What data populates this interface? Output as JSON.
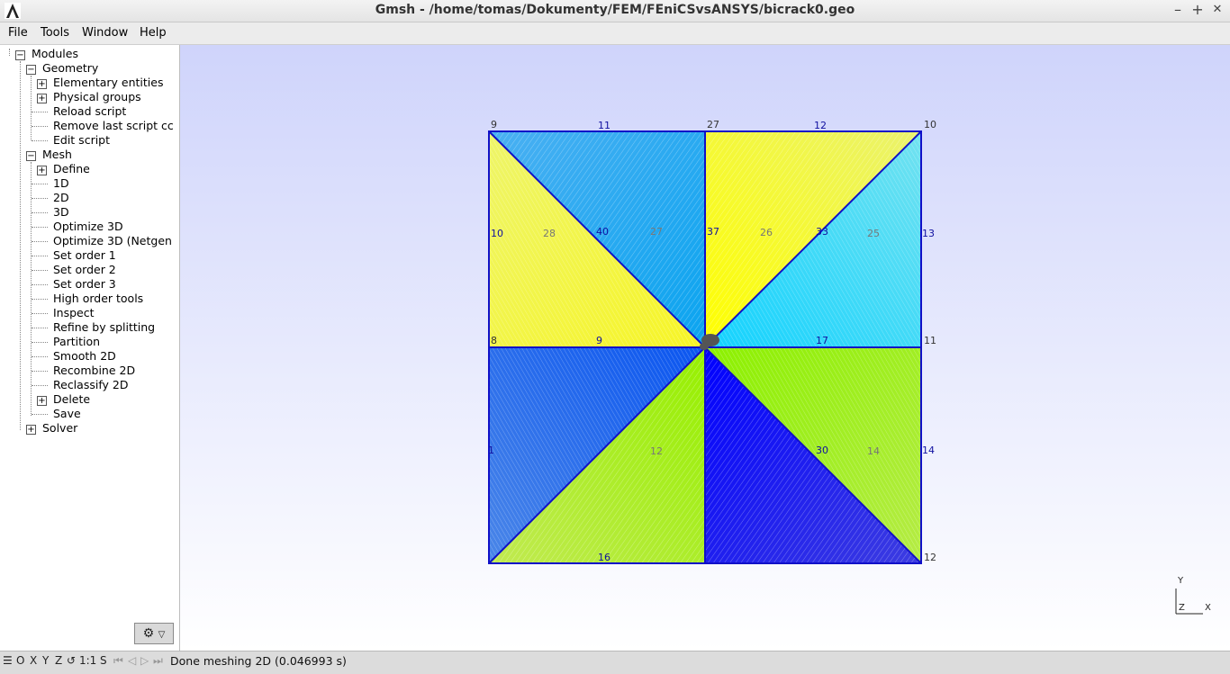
{
  "window": {
    "title": "Gmsh - /home/tomas/Dokumenty/FEM/FEniCSvsANSYS/bicrack0.geo",
    "minimize_label": "–",
    "maximize_label": "+",
    "close_label": "✕"
  },
  "menu": [
    "File",
    "Tools",
    "Window",
    "Help"
  ],
  "tree": {
    "modules": "Modules",
    "geometry": "Geometry",
    "geometry_items": [
      "Elementary entities",
      "Physical groups",
      "Reload script",
      "Remove last script cc",
      "Edit script"
    ],
    "mesh": "Mesh",
    "mesh_items": [
      "Define",
      "1D",
      "2D",
      "3D",
      "Optimize 3D",
      "Optimize 3D (Netgen",
      "Set order 1",
      "Set order 2",
      "Set order 3",
      "High order tools",
      "Inspect",
      "Refine by splitting",
      "Partition",
      "Smooth 2D",
      "Recombine 2D",
      "Reclassify 2D",
      "Delete",
      "Save"
    ],
    "solver": "Solver"
  },
  "statusbar": {
    "buttons": [
      "O",
      "X",
      "Y",
      "Z",
      "1:1",
      "S"
    ],
    "message": "Done meshing 2D (0.046993 s)"
  },
  "axes": {
    "y": "Y",
    "z": "Z",
    "x": "X"
  },
  "mesh_labels": {
    "points": [
      "9",
      "27",
      "10",
      "8",
      "11",
      "12"
    ],
    "curves": [
      "11",
      "12",
      "10",
      "13",
      "40",
      "37",
      "33",
      "9",
      "17",
      "1",
      "14",
      "16",
      "30"
    ],
    "surfaces": [
      "28",
      "27",
      "26",
      "25",
      "12",
      "14"
    ]
  },
  "colors": {
    "edge": "#1010c8",
    "yellow": "#f2f542",
    "light_yellow": "#e9f070",
    "sky": "#3fb2f0",
    "cyan": "#40d8f0",
    "lime": "#a4f020",
    "blue": "#1414e6",
    "mid_blue": "#2a6ae8"
  }
}
